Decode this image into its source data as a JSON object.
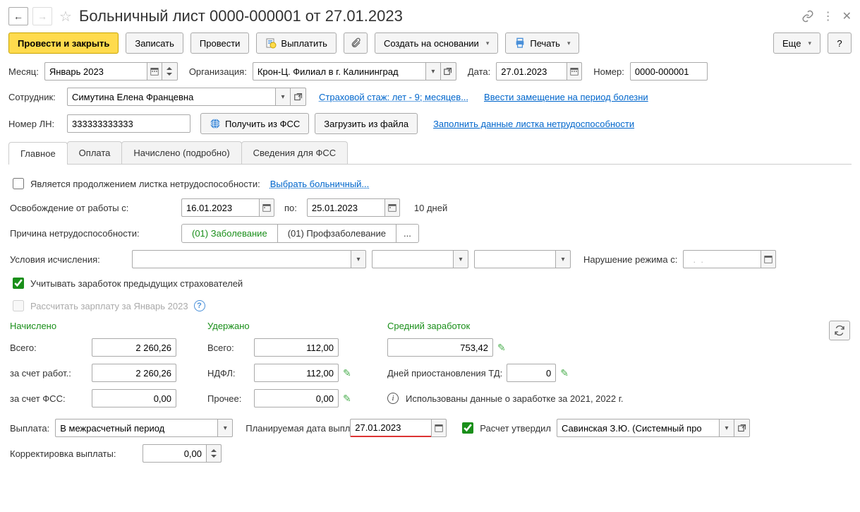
{
  "title": "Больничный лист 0000-000001 от 27.01.2023",
  "toolbar": {
    "provesti_zakryt": "Провести и закрыть",
    "zapisat": "Записать",
    "provesti": "Провести",
    "vyplatit": "Выплатить",
    "sozdat": "Создать на основании",
    "pechat": "Печать",
    "eshche": "Еще",
    "help": "?"
  },
  "hdr": {
    "month_lbl": "Месяц:",
    "month_val": "Январь 2023",
    "org_lbl": "Организация:",
    "org_val": "Крон-Ц. Филиал в г. Калининград",
    "date_lbl": "Дата:",
    "date_val": "27.01.2023",
    "num_lbl": "Номер:",
    "num_val": "0000-000001",
    "employee_lbl": "Сотрудник:",
    "employee_val": "Симутина Елена Францевна",
    "stazh_link": "Страховой стаж: лет - 9; месяцев...",
    "zameshch_link": "Ввести замещение на период болезни",
    "ln_lbl": "Номер ЛН:",
    "ln_val": "333333333333",
    "get_fss": "Получить из ФСС",
    "load_file": "Загрузить из файла",
    "fill_data": "Заполнить данные листка нетрудоспособности"
  },
  "tabs": {
    "main": "Главное",
    "payment": "Оплата",
    "accrued": "Начислено (подробно)",
    "fss": "Сведения для ФСС"
  },
  "main": {
    "is_continuation": "Является продолжением листка нетрудоспособности:",
    "select_bl": "Выбрать больничный...",
    "release_lbl": "Освобождение от работы с:",
    "release_from": "16.01.2023",
    "release_to_lbl": "по:",
    "release_to": "25.01.2023",
    "days": "10 дней",
    "reason_lbl": "Причина нетрудоспособности:",
    "reason1": "(01) Заболевание",
    "reason2": "(01) Профзаболевание",
    "cond_lbl": "Условия исчисления:",
    "violation_lbl": "Нарушение режима с:",
    "violation_val": "  .  .",
    "prev_employers": "Учитывать заработок предыдущих страхователей",
    "calc_salary": "Рассчитать зарплату за Январь 2023",
    "accrued_hdr": "Начислено",
    "withheld_hdr": "Удержано",
    "avg_hdr": "Средний заработок",
    "total_lbl": "Всего:",
    "total_accr": "2 260,26",
    "total_with": "112,00",
    "avg_val": "753,42",
    "employer_lbl": "за счет работ.:",
    "employer_val": "2 260,26",
    "ndfl_lbl": "НДФЛ:",
    "ndfl_val": "112,00",
    "td_days_lbl": "Дней приостановления ТД:",
    "td_days_val": "0",
    "fss_lbl": "за счет ФСС:",
    "fss_val": "0,00",
    "other_lbl": "Прочее:",
    "other_val": "0,00",
    "data_used": "Использованы данные о заработке за  2021,   2022 г.",
    "payout_lbl": "Выплата:",
    "payout_val": "В межрасчетный период",
    "plan_date_lbl": "Планируемая дата выплаты:",
    "plan_date_val": "27.01.2023",
    "approved_lbl": "Расчет утвердил",
    "approved_val": "Савинская З.Ю. (Системный про",
    "corr_lbl": "Корректировка выплаты:",
    "corr_val": "0,00"
  }
}
